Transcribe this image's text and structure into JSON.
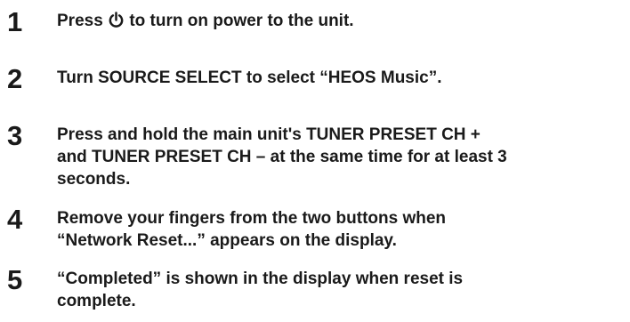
{
  "steps": [
    {
      "number": "1",
      "text_before_icon": "Press ",
      "icon": "power-icon",
      "text_after_icon": " to turn on power to the unit."
    },
    {
      "number": "2",
      "text": "Turn SOURCE SELECT to select “HEOS Music”."
    },
    {
      "number": "3",
      "lines": [
        "Press and hold the main unit's TUNER PRESET CH +",
        "and TUNER PRESET CH – at the same time for at least 3",
        "seconds."
      ]
    },
    {
      "number": "4",
      "lines": [
        "Remove your fingers from the two buttons when",
        "“Network Reset...” appears on the display."
      ]
    },
    {
      "number": "5",
      "lines": [
        "“Completed” is shown in the display when reset is",
        "complete."
      ]
    }
  ]
}
